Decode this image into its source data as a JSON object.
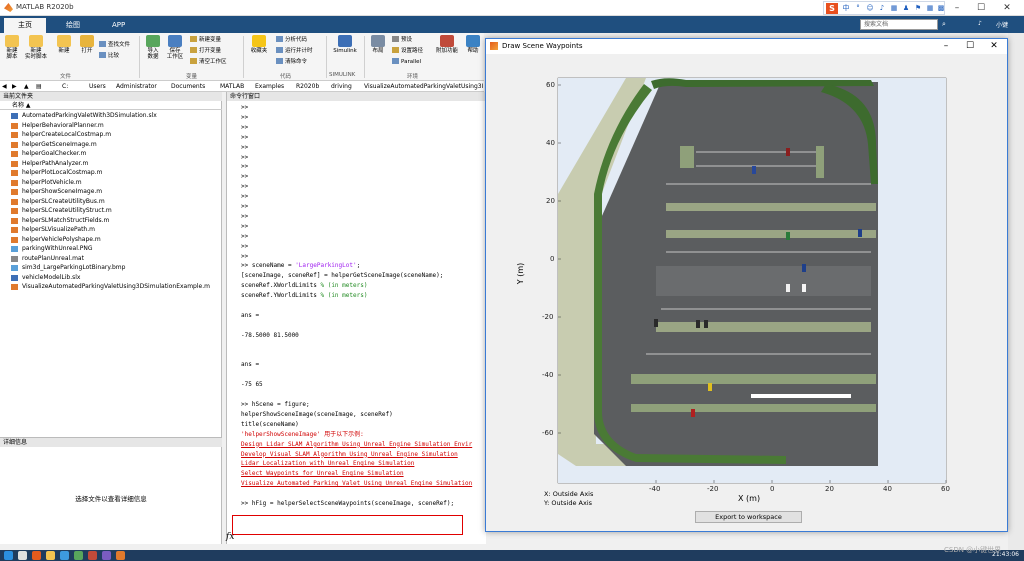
{
  "app": {
    "title": "MATLAB R2020b",
    "tabs": [
      "主页",
      "绘图",
      "APP"
    ],
    "search_placeholder": "搜索文档",
    "user": "小键"
  },
  "ime": {
    "logo": "S",
    "items": [
      "中",
      "°",
      "☺",
      "♪",
      "▦",
      "♟",
      "⚑",
      "▦",
      "▩"
    ]
  },
  "ribbon": {
    "buttons": [
      {
        "label": "新建\n脚本",
        "icon": "new-script-icon",
        "color": "#f3c451"
      },
      {
        "label": "新建\n实时脚本",
        "icon": "new-live-script-icon",
        "color": "#f3c451"
      },
      {
        "label": "新建",
        "icon": "new-icon",
        "color": "#f3c451"
      },
      {
        "label": "打开",
        "icon": "open-icon",
        "color": "#e8b43c"
      },
      {
        "label": "导入\n数据",
        "icon": "import-icon",
        "color": "#58a65c"
      },
      {
        "label": "保存\n工作区",
        "icon": "save-workspace-icon",
        "color": "#4a7fc1"
      },
      {
        "label": "收藏夹",
        "icon": "favorites-icon",
        "color": "#f5c518"
      },
      {
        "label": "Simulink",
        "icon": "simulink-icon",
        "color": "#3d6fb6"
      },
      {
        "label": "布局",
        "icon": "layout-icon",
        "color": "#7a8ca3"
      },
      {
        "label": "附加功能",
        "icon": "addons-icon",
        "color": "#c04a3a"
      },
      {
        "label": "帮助",
        "icon": "help-icon",
        "color": "#3b82c4"
      }
    ],
    "small": {
      "find_files": "查找文件",
      "compare": "比较",
      "new_variable": "新建变量",
      "open_variable": "打开变量",
      "clear_workspace": "清空工作区",
      "analyze_code": "分析代码",
      "run_timing": "运行并计时",
      "clear_commands": "清除命令",
      "preferences": "预设",
      "set_path": "设置路径",
      "parallel": "Parallel"
    },
    "groups": {
      "file": "文件",
      "variable": "变量",
      "code": "代码",
      "simulink": "SIMULINK",
      "env": "环境"
    }
  },
  "address": {
    "crumbs": [
      "C:",
      "Users",
      "Administrator",
      "Documents",
      "MATLAB",
      "Examples",
      "R2020b",
      "driving",
      "VisualizeAutomatedParkingValetUsing3I"
    ]
  },
  "current_folder": {
    "header": "当前文件夹",
    "col_name": "名称 ▲",
    "files": [
      {
        "name": "AutomatedParkingValetWith3DSimulation.slx",
        "color": "#3d6fb6"
      },
      {
        "name": "HelperBehavioralPlanner.m",
        "color": "#e07a2d"
      },
      {
        "name": "helperCreateLocalCostmap.m",
        "color": "#e07a2d"
      },
      {
        "name": "helperGetSceneImage.m",
        "color": "#e07a2d"
      },
      {
        "name": "helperGoalChecker.m",
        "color": "#e07a2d"
      },
      {
        "name": "HelperPathAnalyzer.m",
        "color": "#e07a2d"
      },
      {
        "name": "helperPlotLocalCostmap.m",
        "color": "#e07a2d"
      },
      {
        "name": "helperPlotVehicle.m",
        "color": "#e07a2d"
      },
      {
        "name": "helperShowSceneImage.m",
        "color": "#e07a2d"
      },
      {
        "name": "helperSLCreateUtilityBus.m",
        "color": "#e07a2d"
      },
      {
        "name": "helperSLCreateUtilityStruct.m",
        "color": "#e07a2d"
      },
      {
        "name": "helperSLMatchStructFields.m",
        "color": "#e07a2d"
      },
      {
        "name": "helperSLVisualizePath.m",
        "color": "#e07a2d"
      },
      {
        "name": "helperVehiclePolyshape.m",
        "color": "#e07a2d"
      },
      {
        "name": "parkingWithUnreal.PNG",
        "color": "#5aa0d8"
      },
      {
        "name": "routePlanUnreal.mat",
        "color": "#888888"
      },
      {
        "name": "sim3d_LargeParkingLotBinary.bmp",
        "color": "#5aa0d8"
      },
      {
        "name": "vehicleModelLib.slx",
        "color": "#3d6fb6"
      },
      {
        "name": "VisualizeAutomatedParkingValetUsing3DSimulationExample.m",
        "color": "#e07a2d"
      }
    ]
  },
  "details": {
    "header": "详细信息",
    "message": "选择文件以查看详细信息"
  },
  "command": {
    "header": "命令行窗口",
    "lines": [
      {
        "t": ">>",
        "k": "p"
      },
      {
        "t": ">>",
        "k": "p"
      },
      {
        "t": ">>",
        "k": "p"
      },
      {
        "t": ">>",
        "k": "p"
      },
      {
        "t": ">>",
        "k": "p"
      },
      {
        "t": ">>",
        "k": "p"
      },
      {
        "t": ">>",
        "k": "p"
      },
      {
        "t": ">>",
        "k": "p"
      },
      {
        "t": ">>",
        "k": "p"
      },
      {
        "t": ">>",
        "k": "p"
      },
      {
        "t": ">>",
        "k": "p"
      },
      {
        "t": ">>",
        "k": "p"
      },
      {
        "t": ">>",
        "k": "p"
      },
      {
        "t": ">>",
        "k": "p"
      },
      {
        "t": ">>",
        "k": "p"
      },
      {
        "t": ">>",
        "k": "p"
      },
      {
        "t": ">> sceneName = ",
        "s": "'LargeParkingLot'",
        "e": ";",
        "k": "c"
      },
      {
        "t": "[sceneImage, sceneRef] = helperGetSceneImage(sceneName);",
        "k": "p"
      },
      {
        "t": "sceneRef.XWorldLimits   ",
        "c": "% (in meters)",
        "k": "c"
      },
      {
        "t": "sceneRef.YWorldLimits   ",
        "c": "% (in meters)",
        "k": "c"
      },
      {
        "t": "",
        "k": "p"
      },
      {
        "t": "ans =",
        "k": "p"
      },
      {
        "t": "",
        "k": "p"
      },
      {
        "t": "  -78.5000   81.5000",
        "k": "p"
      },
      {
        "t": "",
        "k": "p"
      },
      {
        "t": "",
        "k": "p"
      },
      {
        "t": "ans =",
        "k": "p"
      },
      {
        "t": "",
        "k": "p"
      },
      {
        "t": "   -75    65",
        "k": "p"
      },
      {
        "t": "",
        "k": "p"
      },
      {
        "t": ">> hScene = figure;",
        "k": "p"
      },
      {
        "t": "helperShowSceneImage(sceneImage, sceneRef)",
        "k": "p"
      },
      {
        "t": "title(sceneName)",
        "k": "p"
      },
      {
        "t": "'helperShowSceneImage' 用于以下示例:",
        "k": "err"
      },
      {
        "t": "  Design Lidar SLAM Algorithm Using Unreal Engine Simulation Envir",
        "k": "link"
      },
      {
        "t": "  Develop Visual SLAM Algorithm Using Unreal Engine Simulation",
        "k": "link"
      },
      {
        "t": "  Lidar Localization with Unreal Engine Simulation",
        "k": "link"
      },
      {
        "t": "  Select Waypoints for Unreal Engine Simulation",
        "k": "link"
      },
      {
        "t": "  Visualize Automated Parking Valet Using Unreal Engine Simulation",
        "k": "link"
      },
      {
        "t": "",
        "k": "p"
      },
      {
        "t": ">> hFig = helperSelectSceneWaypoints(sceneImage, sceneRef);",
        "k": "p"
      }
    ],
    "fx": "fx"
  },
  "figure": {
    "title": "Draw Scene Waypoints",
    "x_label": "X (m)",
    "y_label": "Y (m)",
    "x_ticks": [
      "-40",
      "-20",
      "0",
      "20",
      "40",
      "60"
    ],
    "y_ticks": [
      "60",
      "40",
      "20",
      "0",
      "-20",
      "-40",
      "-60"
    ],
    "x_readout": "X: Outside Axis",
    "y_readout": "Y: Outside Axis",
    "export_label": "Export to workspace"
  },
  "taskbar": {
    "time": "21:43:06",
    "watermark": "CSDN @小键世界"
  }
}
